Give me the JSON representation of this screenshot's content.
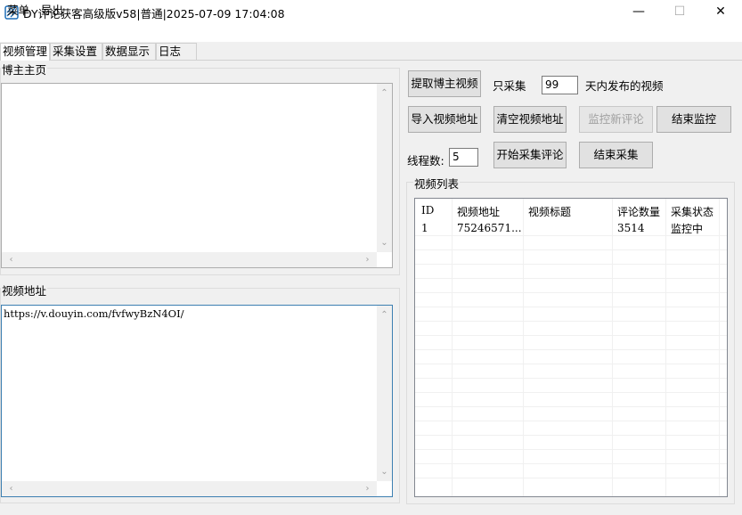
{
  "window": {
    "title": "DY评论获客高级版v58|普通|2025-07-09 17:04:08",
    "minimize": "—",
    "maximize": "☐",
    "close": "✕"
  },
  "menu": {
    "items": [
      "菜单",
      "导出"
    ]
  },
  "tabs": [
    "视频管理",
    "采集设置",
    "数据显示",
    "日志"
  ],
  "active_tab": "视频管理",
  "blogger_home": {
    "label": "博主主页",
    "value": ""
  },
  "video_url": {
    "label": "视频地址",
    "value": "https://v.douyin.com/fvfwyBzN4OI/"
  },
  "controls": {
    "fetch_blogger_videos": "提取博主视频",
    "only_collect_prefix": "只采集",
    "days_value": "99",
    "days_suffix": "天内发布的视频",
    "import_video_url": "导入视频地址",
    "clear_video_url": "清空视频地址",
    "monitor_new_comments": "监控新评论",
    "stop_monitoring": "结束监控",
    "threads_label": "线程数:",
    "threads_value": "5",
    "start_collect_comments": "开始采集评论",
    "stop_collect": "结束采集"
  },
  "video_list": {
    "label": "视频列表",
    "columns": [
      "ID",
      "视频地址",
      "视频标题",
      "评论数量",
      "采集状态"
    ],
    "rows": [
      {
        "id": "1",
        "url": "75246571...",
        "title": "",
        "comments": "3514",
        "status": "监控中"
      }
    ]
  }
}
